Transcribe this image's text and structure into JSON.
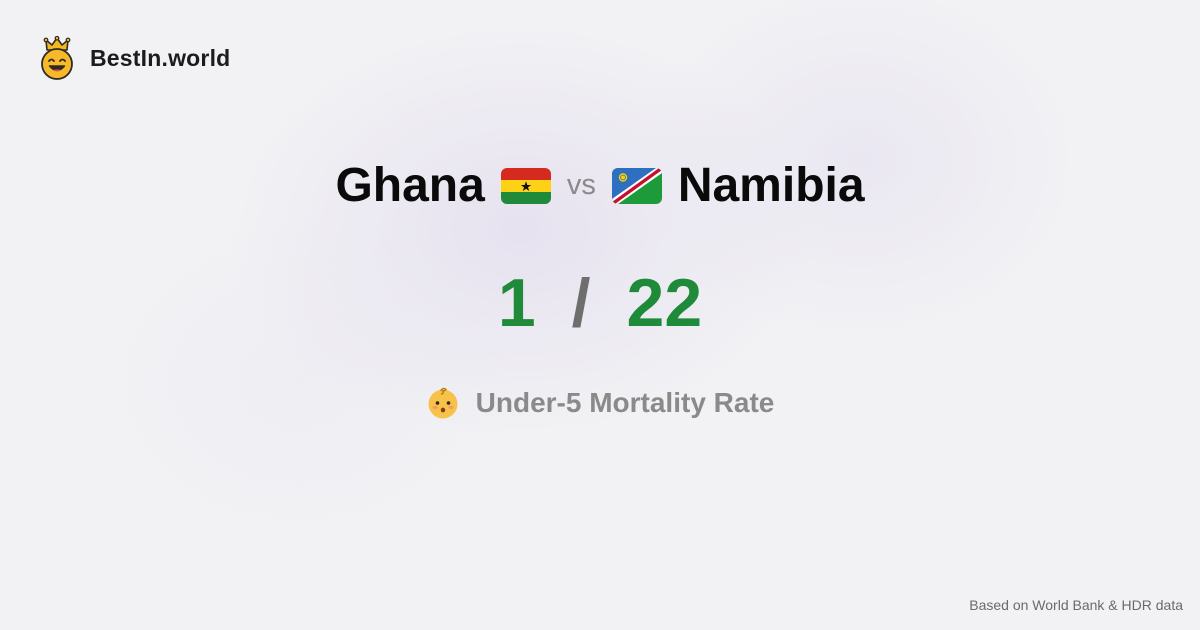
{
  "brand": {
    "name": "BestIn.world",
    "logo_icon": "crowned-smiley-icon"
  },
  "comparison": {
    "country_a": {
      "name": "Ghana",
      "flag_icon": "ghana-flag-icon",
      "score": "1"
    },
    "vs_label": "vs",
    "country_b": {
      "name": "Namibia",
      "flag_icon": "namibia-flag-icon",
      "score": "22"
    },
    "separator": "/"
  },
  "metric": {
    "icon": "baby-face-icon",
    "label": "Under-5 Mortality Rate"
  },
  "footer": {
    "source": "Based on World Bank & HDR data"
  },
  "colors": {
    "score": "#1f8a3a",
    "muted": "#8a8a8a",
    "background": "#f2f2f4"
  }
}
